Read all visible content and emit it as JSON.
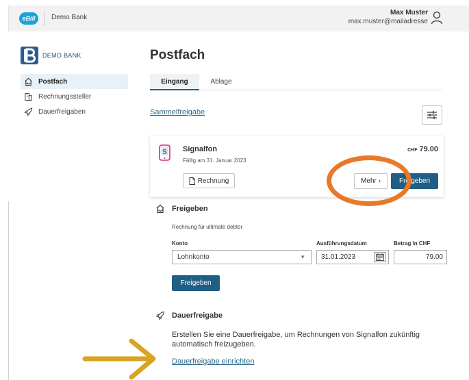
{
  "header": {
    "logo_text": "eBill",
    "bank_name": "Demo Bank",
    "user_name": "Max Muster",
    "user_email": "max.muster@mailadresse"
  },
  "sidebar": {
    "brand": "DEMO BANK",
    "items": [
      {
        "label": "Postfach",
        "icon": "inbox-icon",
        "active": true
      },
      {
        "label": "Rechnungssteller",
        "icon": "building-icon",
        "active": false
      },
      {
        "label": "Dauerfreigaben",
        "icon": "rocket-icon",
        "active": false
      }
    ]
  },
  "main": {
    "title": "Postfach",
    "tabs": [
      {
        "label": "Eingang",
        "active": true
      },
      {
        "label": "Ablage",
        "active": false
      }
    ],
    "bulk_link": "Sammelfreigabe"
  },
  "invoice": {
    "payee": "Signalfon",
    "due": "Fällig am 31. Januar 2023",
    "currency": "CHF",
    "amount": "79.00",
    "btn_invoice": "Rechnung",
    "btn_more": "Mehr ›",
    "btn_approve": "Freigeben"
  },
  "approve": {
    "title": "Freigeben",
    "subtitle": "Rechnung für ultimate debtor",
    "label_account": "Konto",
    "label_date": "Ausführungsdatum",
    "label_amount": "Betrag in CHF",
    "account_value": "Lohnkonto",
    "date_value": "31.01.2023",
    "amount_value": "79.00",
    "btn_approve": "Freigeben"
  },
  "standing": {
    "title": "Dauerfreigabe",
    "text": "Erstellen Sie eine Dauerfreigabe, um Rechnungen von Signalfon zukünftig automatisch freizugeben.",
    "link": "Dauerfreigabe einrichten"
  },
  "colors": {
    "primary": "#1f5f86",
    "link": "#2b6a8a",
    "annotation_circle": "#e8792a",
    "annotation_arrow": "#d9a324",
    "ebill_blue": "#1aa3d8"
  }
}
